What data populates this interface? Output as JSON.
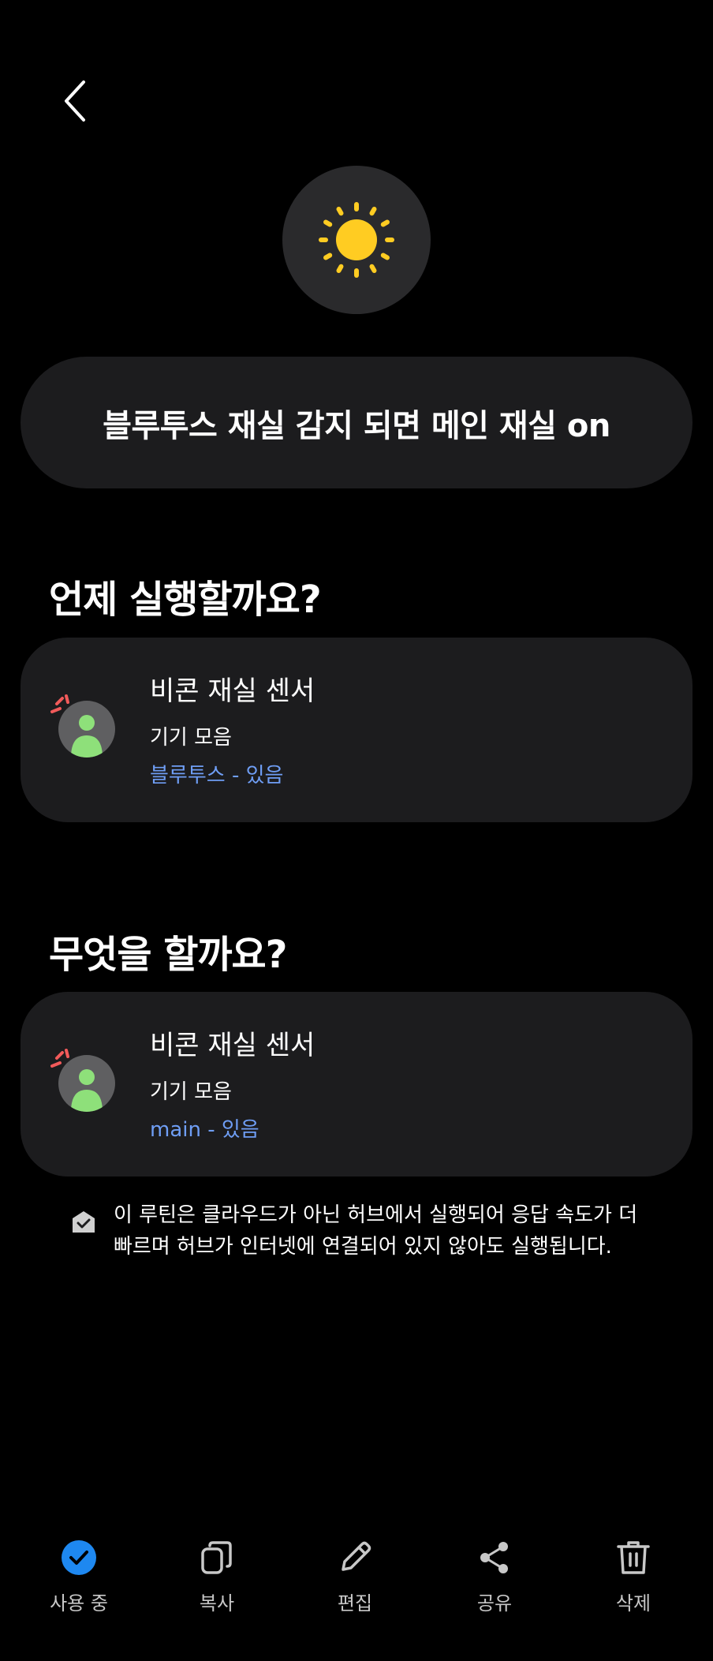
{
  "routine": {
    "title": "블루투스 재실 감지 되면 메인 재실 on",
    "icon": "sun-icon",
    "icon_color": "#FFCC22"
  },
  "when": {
    "heading": "언제 실행할까요?",
    "device_name": "비콘 재실 센서",
    "device_group": "기기 모음",
    "condition": "블루투스 - 있음"
  },
  "then": {
    "heading": "무엇을 할까요?",
    "device_name": "비콘 재실 센서",
    "device_group": "기기 모음",
    "action": "main - 있음"
  },
  "hub_note": {
    "text": "이 루틴은 클라우드가 아닌 허브에서 실행되어 응답 속도가 더 빠르며 허브가 인터넷에 연결되어 있지 않아도 실행됩니다.",
    "icon": "hub-check-icon"
  },
  "bottom_bar": {
    "in_use": "사용 중",
    "copy": "복사",
    "edit": "편집",
    "share": "공유",
    "delete": "삭제"
  },
  "colors": {
    "accent_blue": "#1E88F0",
    "link_blue": "#6F9EF5",
    "card_bg": "#1C1C1E",
    "avatar_green": "#8EE07A",
    "alert_red": "#F15A5A"
  }
}
